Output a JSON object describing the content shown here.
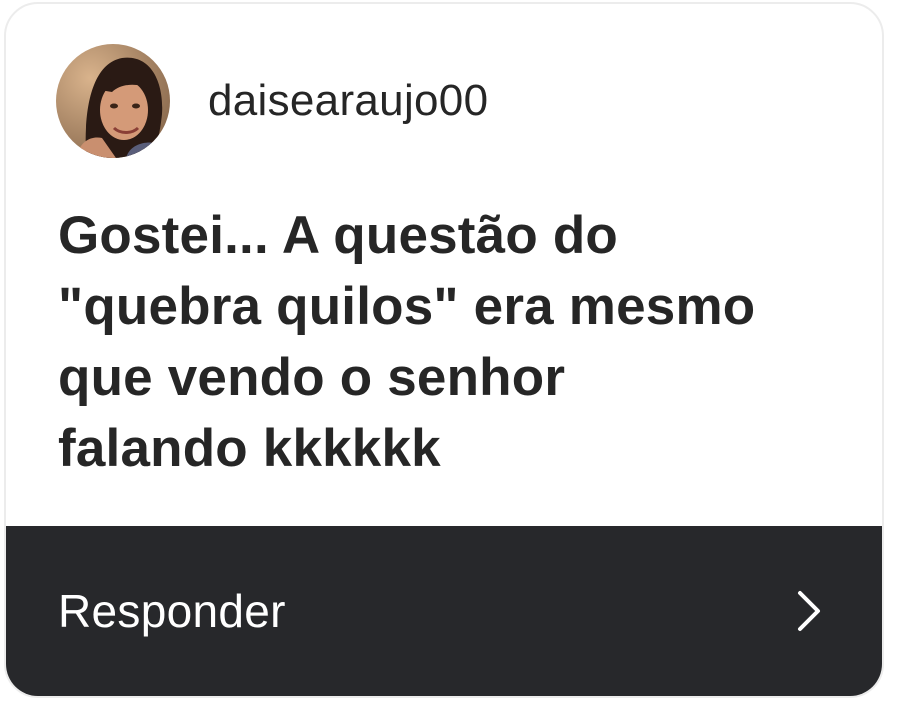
{
  "story_reply": {
    "username": "daisearaujo00",
    "message_lines": [
      "Gostei... A questão do",
      "\"quebra quilos\" era mesmo",
      "que vendo o senhor",
      "falando kkkkkk"
    ],
    "reply_label": "Responder",
    "reply_icon": "chevron-right-icon"
  },
  "colors": {
    "card_background": "#ffffff",
    "text_primary": "#262626",
    "footer_background": "#27282b",
    "footer_text": "#ffffff"
  }
}
